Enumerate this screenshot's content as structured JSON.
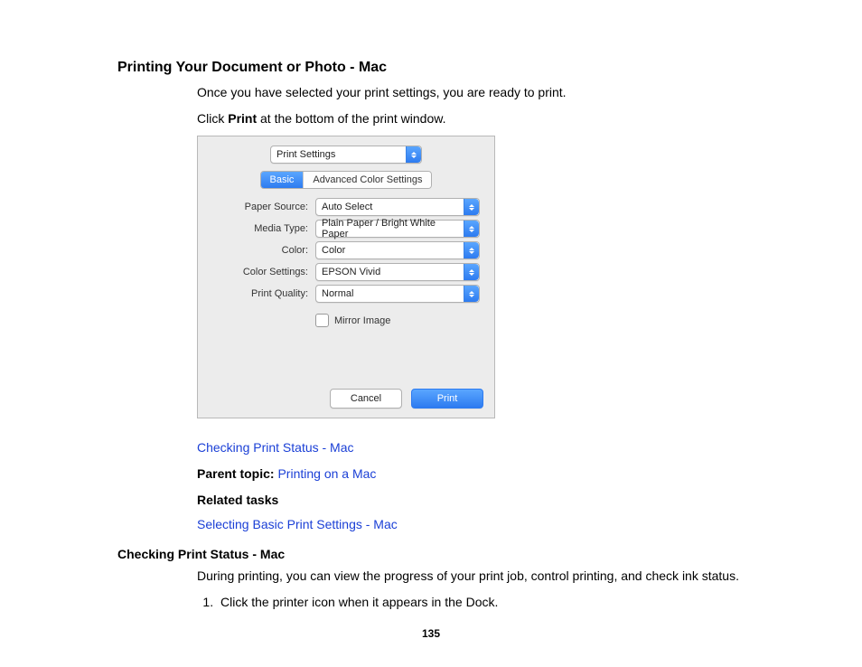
{
  "title": "Printing Your Document or Photo - Mac",
  "intro1": "Once you have selected your print settings, you are ready to print.",
  "intro2_pre": "Click ",
  "intro2_bold": "Print",
  "intro2_post": " at the bottom of the print window.",
  "dialog": {
    "top_popup": "Print Settings",
    "tabs": {
      "basic": "Basic",
      "advanced": "Advanced Color Settings"
    },
    "rows": {
      "paper_source": {
        "label": "Paper Source:",
        "value": "Auto Select"
      },
      "media_type": {
        "label": "Media Type:",
        "value": "Plain Paper / Bright White Paper"
      },
      "color": {
        "label": "Color:",
        "value": "Color"
      },
      "color_settings": {
        "label": "Color Settings:",
        "value": "EPSON Vivid"
      },
      "print_quality": {
        "label": "Print Quality:",
        "value": "Normal"
      }
    },
    "mirror_label": "Mirror Image",
    "cancel": "Cancel",
    "print": "Print"
  },
  "links": {
    "check_status": "Checking Print Status - Mac",
    "parent_label": "Parent topic: ",
    "parent_link": "Printing on a Mac",
    "related_label": "Related tasks",
    "related_link": "Selecting Basic Print Settings - Mac"
  },
  "subhead": "Checking Print Status - Mac",
  "sub_intro": "During printing, you can view the progress of your print job, control printing, and check ink status.",
  "step1": "Click the printer icon when it appears in the Dock.",
  "page_number": "135"
}
